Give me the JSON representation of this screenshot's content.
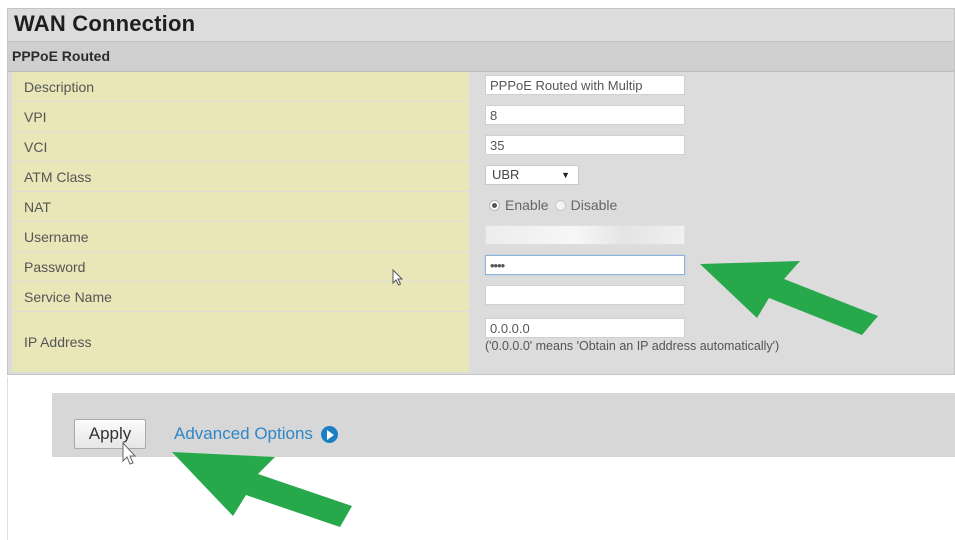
{
  "panel": {
    "title": "WAN Connection",
    "section": "PPPoE Routed"
  },
  "fields": {
    "description": {
      "label": "Description",
      "value": "PPPoE Routed with Multip"
    },
    "vpi": {
      "label": "VPI",
      "value": "8"
    },
    "vci": {
      "label": "VCI",
      "value": "35"
    },
    "atm_class": {
      "label": "ATM Class",
      "selected": "UBR"
    },
    "nat": {
      "label": "NAT",
      "options": [
        "Enable",
        "Disable"
      ],
      "selected": "Enable"
    },
    "username": {
      "label": "Username",
      "value": ""
    },
    "password": {
      "label": "Password",
      "value": "••••"
    },
    "service_name": {
      "label": "Service Name",
      "value": ""
    },
    "ip_address": {
      "label": "IP Address",
      "value": "0.0.0.0",
      "hint": "('0.0.0.0' means 'Obtain an IP address automatically')"
    }
  },
  "actions": {
    "apply_label": "Apply",
    "advanced_label": "Advanced Options"
  },
  "colors": {
    "label_bg": "#e9e6b8",
    "arrow": "#27a84a",
    "link": "#2f86c8"
  },
  "icons": [
    "mouse-cursor-icon",
    "green-arrow-icon",
    "play-circle-icon",
    "dropdown-arrow-icon"
  ]
}
